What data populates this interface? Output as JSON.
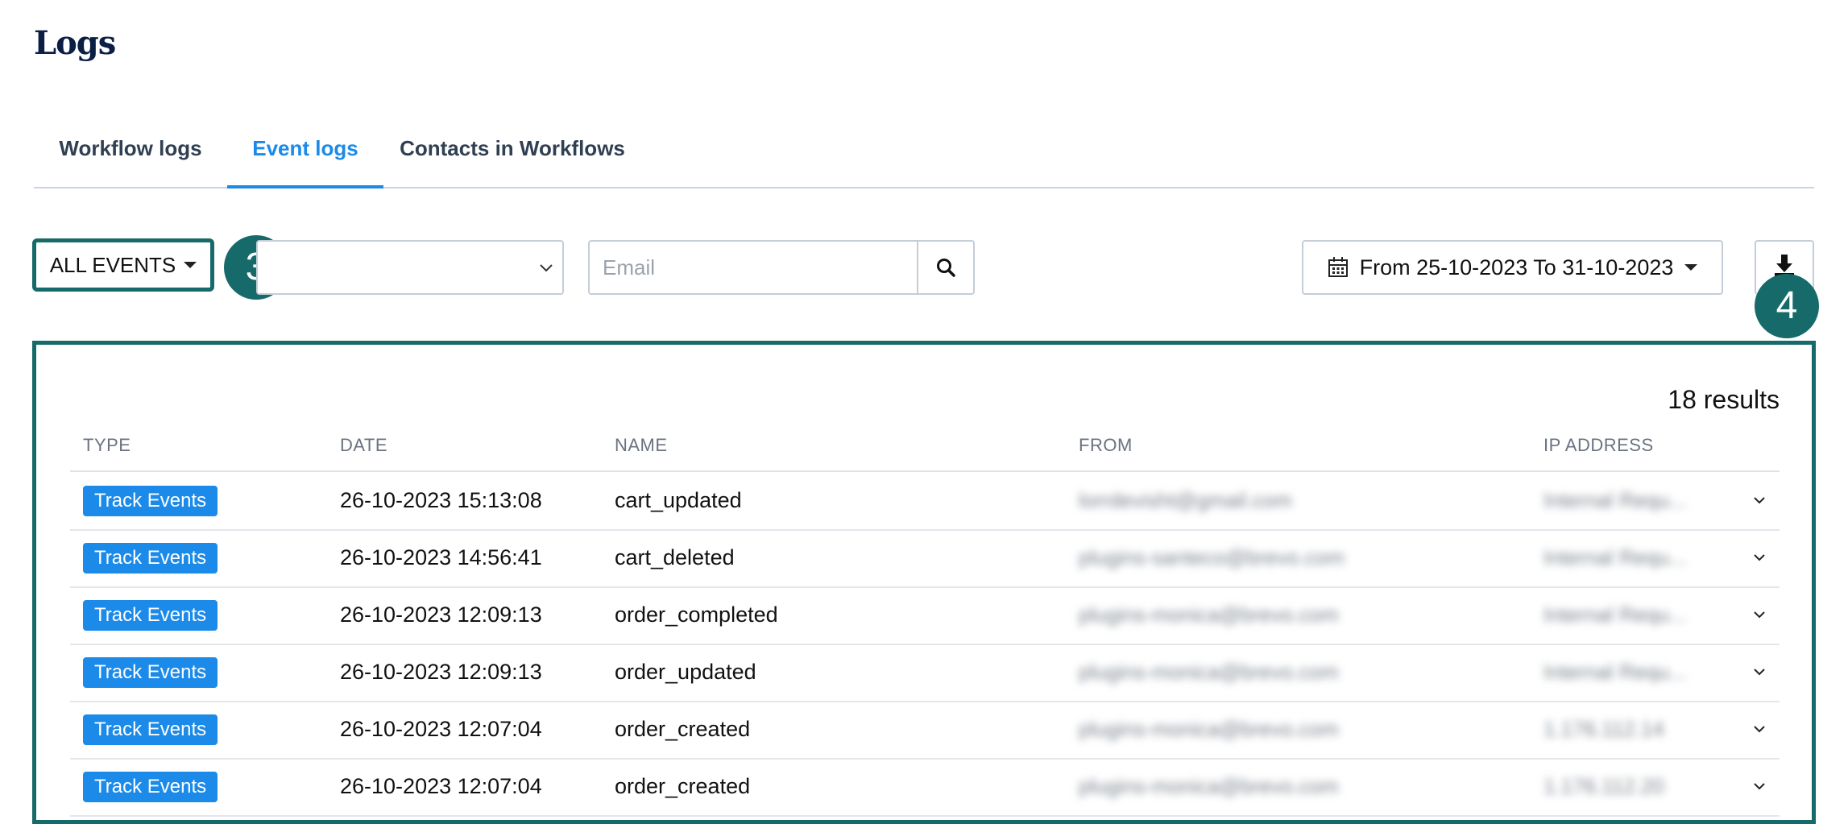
{
  "page": {
    "title": "Logs"
  },
  "tabs": [
    {
      "label": "Workflow logs",
      "active": false
    },
    {
      "label": "Event logs",
      "active": true
    },
    {
      "label": "Contacts in Workflows",
      "active": false
    }
  ],
  "filters": {
    "events_label": "ALL EVENTS",
    "second_select_value": "",
    "email_placeholder": "Email",
    "date_range": "From 25-10-2023 To 31-10-2023"
  },
  "markers": {
    "m3": "3",
    "m4": "4"
  },
  "results": {
    "count_label": "18 results",
    "columns": [
      "TYPE",
      "DATE",
      "NAME",
      "FROM",
      "IP ADDRESS"
    ],
    "rows": [
      {
        "type": "Track Events",
        "date": "26-10-2023 15:13:08",
        "name": "cart_updated",
        "from": "lorrdevisht@gmail.com",
        "ip": "Internal Requ..."
      },
      {
        "type": "Track Events",
        "date": "26-10-2023 14:56:41",
        "name": "cart_deleted",
        "from": "plugins-santeco@brevo.com",
        "ip": "Internal Requ..."
      },
      {
        "type": "Track Events",
        "date": "26-10-2023 12:09:13",
        "name": "order_completed",
        "from": "plugins-monica@brevo.com",
        "ip": "Internal Requ..."
      },
      {
        "type": "Track Events",
        "date": "26-10-2023 12:09:13",
        "name": "order_updated",
        "from": "plugins-monica@brevo.com",
        "ip": "Internal Requ..."
      },
      {
        "type": "Track Events",
        "date": "26-10-2023 12:07:04",
        "name": "order_created",
        "from": "plugins-monica@brevo.com",
        "ip": "1.176.112.14"
      },
      {
        "type": "Track Events",
        "date": "26-10-2023 12:07:04",
        "name": "order_created",
        "from": "plugins-monica@brevo.com",
        "ip": "1.176.112.20"
      }
    ]
  },
  "colors": {
    "accent": "#1b8ae8",
    "highlight": "#176a6a",
    "badge": "#1b8ae8"
  }
}
